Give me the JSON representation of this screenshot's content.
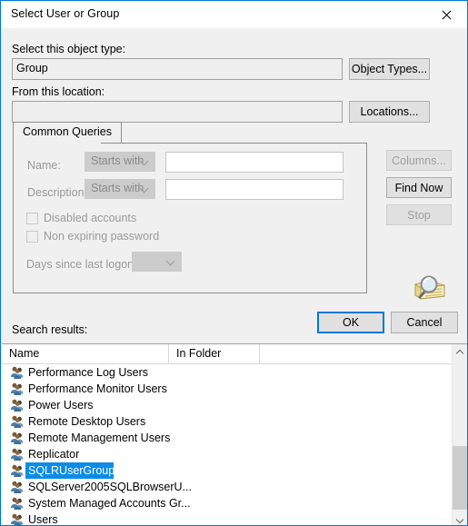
{
  "window": {
    "title": "Select User or Group",
    "close_icon": "close-icon"
  },
  "object_type": {
    "label": "Select this object type:",
    "value": "Group",
    "button": "Object Types..."
  },
  "location": {
    "label": "From this location:",
    "value": "",
    "button": "Locations..."
  },
  "tabs": [
    {
      "label": "Common Queries"
    }
  ],
  "common_queries": {
    "name": {
      "label": "Name:",
      "condition": "Starts with",
      "value": ""
    },
    "description": {
      "label": "Description:",
      "condition": "Starts with",
      "value": ""
    },
    "disabled_accounts": {
      "label": "Disabled accounts",
      "checked": false
    },
    "non_expiring_password": {
      "label": "Non expiring password",
      "checked": false
    },
    "days_since_last_logon": {
      "label": "Days since last logon:",
      "value": ""
    }
  },
  "side_buttons": {
    "columns": "Columns...",
    "find_now": "Find Now",
    "stop": "Stop",
    "icon": "magnifier-folder-icon"
  },
  "dialog_buttons": {
    "ok": "OK",
    "cancel": "Cancel"
  },
  "results": {
    "label": "Search results:",
    "columns": [
      "Name",
      "In Folder"
    ],
    "rows": [
      {
        "name": "Performance Log Users",
        "in_folder": "",
        "selected": false
      },
      {
        "name": "Performance Monitor Users",
        "in_folder": "",
        "selected": false
      },
      {
        "name": "Power Users",
        "in_folder": "",
        "selected": false
      },
      {
        "name": "Remote Desktop Users",
        "in_folder": "",
        "selected": false
      },
      {
        "name": "Remote Management Users",
        "in_folder": "",
        "selected": false
      },
      {
        "name": "Replicator",
        "in_folder": "",
        "selected": false
      },
      {
        "name": "SQLRUserGroup",
        "in_folder": "",
        "selected": true
      },
      {
        "name": "SQLServer2005SQLBrowserU...",
        "in_folder": "",
        "selected": false
      },
      {
        "name": "System Managed Accounts Gr...",
        "in_folder": "",
        "selected": false
      },
      {
        "name": "Users",
        "in_folder": "",
        "selected": false
      }
    ],
    "scrollbar": {
      "up_icon": "chevron-up-icon",
      "down_icon": "chevron-down-icon"
    }
  },
  "colors": {
    "accent": "#0078d7",
    "selection": "#0a8ce8"
  }
}
